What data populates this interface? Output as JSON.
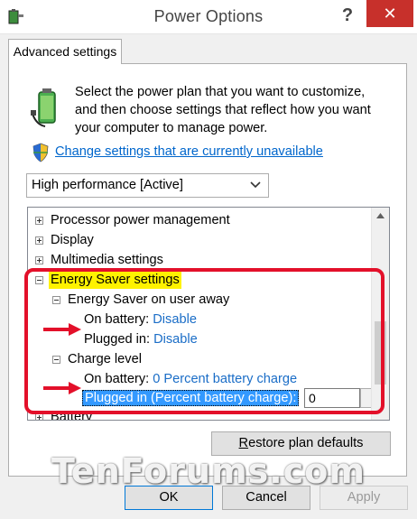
{
  "window": {
    "title": "Power Options",
    "help_label": "?",
    "close_label": "✕"
  },
  "tab": {
    "label": "Advanced settings"
  },
  "description": "Select the power plan that you want to customize, and then choose settings that reflect how you want your computer to manage power.",
  "change_settings_link": "Change settings that are currently unavailable",
  "plan_select": {
    "selected": "High performance [Active]"
  },
  "tree": {
    "processor": "Processor power management",
    "display": "Display",
    "multimedia": "Multimedia settings",
    "energy_saver": "Energy Saver settings",
    "away": "Energy Saver on user away",
    "away_on_battery_label": "On battery:",
    "away_on_battery_value": "Disable",
    "away_plugged_label": "Plugged in:",
    "away_plugged_value": "Disable",
    "charge_level": "Charge level",
    "charge_on_battery_label": "On battery:",
    "charge_on_battery_value": "0 Percent battery charge",
    "charge_plugged_label": "Plugged in (Percent battery charge):",
    "charge_plugged_input": "0",
    "battery": "Battery"
  },
  "restore_button": {
    "label_prefix": "",
    "label_underlined": "R",
    "label_rest": "estore plan defaults"
  },
  "watermark": "TenForums.com",
  "buttons": {
    "ok": "OK",
    "cancel": "Cancel",
    "apply": "Apply"
  },
  "colors": {
    "link": "#0066cc",
    "highlight": "#fff200",
    "annotation_red": "#e3102a",
    "selection": "#3399ff",
    "close": "#c7302b"
  },
  "icons": [
    "power-options-icon",
    "battery-plug-icon",
    "uac-shield-icon",
    "chevron-down-icon",
    "expander-minus-icon",
    "expander-plus-icon",
    "red-arrow-icon"
  ]
}
